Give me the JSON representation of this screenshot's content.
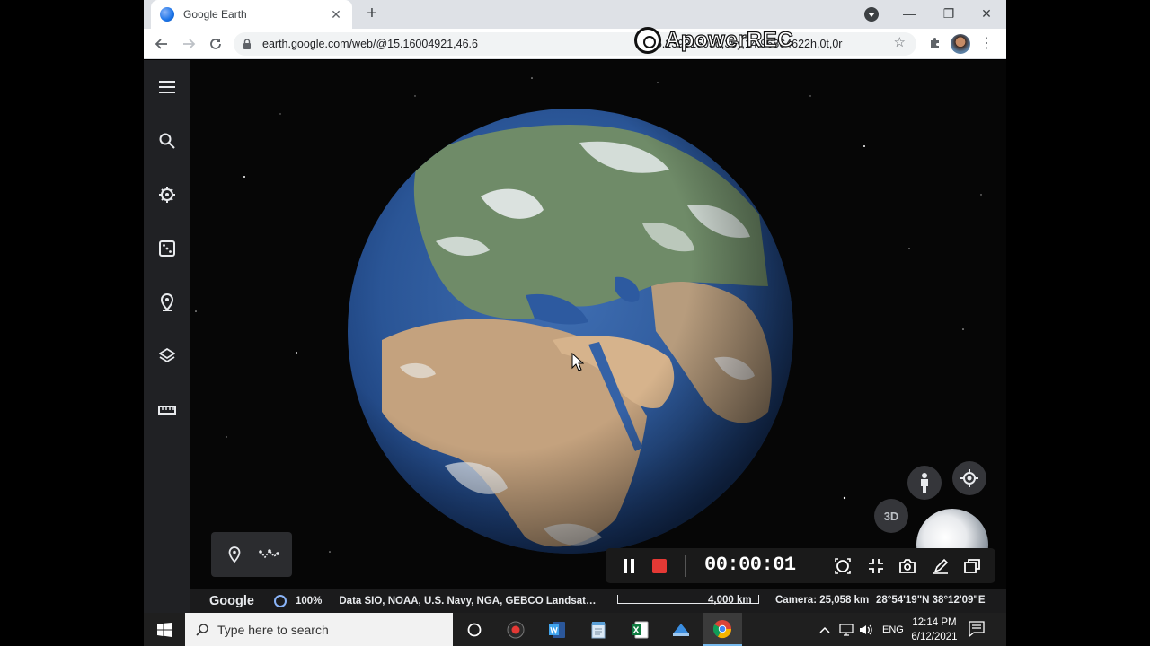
{
  "browser": {
    "tab_title": "Google Earth",
    "url": "earth.google.com/web/@15.16004921,46.6…605.23931505d,35y,14.96864622h,0t,0r",
    "url_prefix": "earth.google.com/web/@15.16004921,46.6",
    "url_suffix": "605.23931505d,35y,14.96864622h,0t,0r",
    "tab_close_glyph": "✕",
    "new_tab_glyph": "+",
    "minimize_glyph": "—",
    "maximize_glyph": "❐",
    "close_glyph": "✕",
    "star_glyph": "☆",
    "menu_glyph": "⋮"
  },
  "watermark": {
    "text": "ApowerREC"
  },
  "earth": {
    "sidebar_icons": [
      "menu-icon",
      "search-icon",
      "voyager-icon",
      "feeling-lucky-icon",
      "projects-icon",
      "map-style-icon",
      "measure-icon"
    ],
    "place_panel_icons": [
      "place-mark-icon",
      "line-path-icon"
    ],
    "button_3d": "3D",
    "status": {
      "logo": "Google",
      "zoom": "100%",
      "data_credits": "Data SIO, NOAA, U.S. Navy, NGA, GEBCO  Landsat…",
      "scale": "4,000 km",
      "camera": "Camera: 25,058 km",
      "coords": "28°54'19\"N 38°12'09\"E"
    }
  },
  "recorder": {
    "timer": "00:00:01"
  },
  "taskbar": {
    "search_placeholder": "Type here to search",
    "lang": "ENG",
    "time": "12:14 PM",
    "date": "6/12/2021",
    "app_icons": [
      "cortana-icon",
      "apowerrec-icon",
      "word-icon",
      "notepad-icon",
      "excel-icon",
      "app-icon",
      "chrome-icon"
    ]
  },
  "colors": {
    "accent_blue": "#1a73e8",
    "record_red": "#e53935",
    "sidebar_bg": "#202124"
  }
}
